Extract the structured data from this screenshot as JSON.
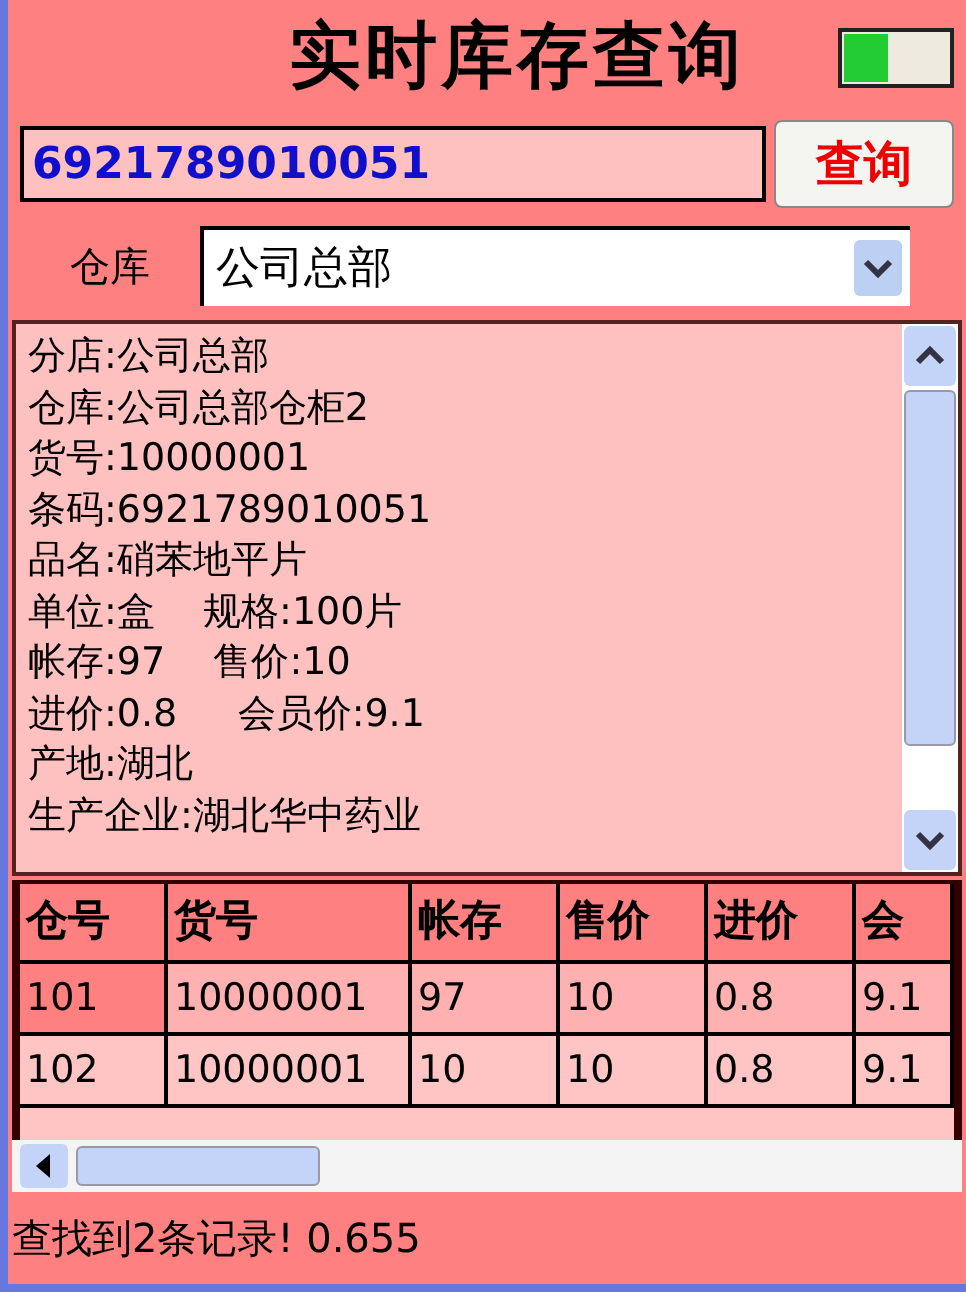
{
  "title": "实时库存查询",
  "search": {
    "value": "6921789010051",
    "button": "查询"
  },
  "warehouse": {
    "label": "仓库",
    "value": "公司总部"
  },
  "details": [
    "分店:公司总部",
    "仓库:公司总部仓柜2",
    "货号:10000001",
    "条码:6921789010051",
    "品名:硝苯地平片",
    "单位:盒    规格:100片",
    "帐存:97    售价:10",
    "进价:0.8     会员价:9.1",
    "产地:湖北",
    "生产企业:湖北华中药业"
  ],
  "table": {
    "columns": [
      "仓号",
      "货号",
      "帐存",
      "售价",
      "进价",
      "会"
    ],
    "rows": [
      {
        "selected": true,
        "cells": [
          "101",
          "10000001",
          "97",
          "10",
          "0.8",
          "9.1"
        ]
      },
      {
        "selected": false,
        "cells": [
          "102",
          "10000001",
          "10",
          "10",
          "0.8",
          "9.1"
        ]
      }
    ]
  },
  "status_bar": "查找到2条记录! 0.655"
}
